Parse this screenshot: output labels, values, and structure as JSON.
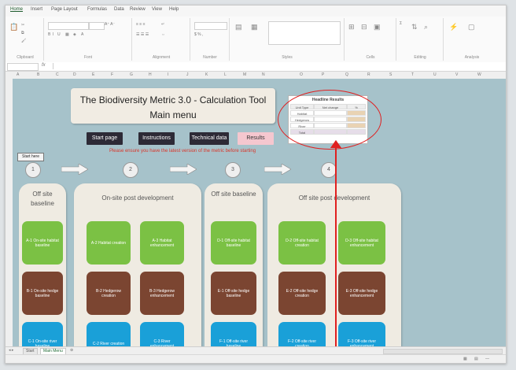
{
  "ribbon": {
    "tabs": [
      "Home",
      "Insert",
      "Page Layout",
      "Formulas",
      "Data",
      "Review",
      "View",
      "Help"
    ],
    "groups": [
      "Clipboard",
      "Font",
      "Alignment",
      "Number",
      "Styles",
      "Cells",
      "Editing",
      "Analysis"
    ]
  },
  "sheet": {
    "title_line1": "The Biodiversity Metric 3.0 - Calculation Tool",
    "title_line2": "Main menu",
    "nav_buttons": [
      "Start page",
      "Instructions",
      "Technical data",
      "Results"
    ],
    "warning": "Please ensure you have the latest version of the metric before starting",
    "start_here": "Start here",
    "steps": [
      "1",
      "2",
      "3",
      "4"
    ],
    "headline": {
      "title": "Headline Results",
      "cols": [
        "Unit Type",
        "Net change",
        "%"
      ],
      "rows": [
        "Habitat",
        "Hedgerow",
        "River",
        "Total"
      ]
    },
    "panels": [
      {
        "title": "Off site baseline",
        "cards": [
          "A-1 On-site habitat baseline",
          "B-1 On-site hedge baseline",
          "C-1 On-site river baseline"
        ]
      },
      {
        "title": "On-site post development",
        "cards": [
          "A-2 Habitat creation",
          "A-3 Habitat enhancement",
          "B-2 Hedgerow creation",
          "B-3 Hedgerow enhancement",
          "C-2 River creation",
          "C-3 River enhancement"
        ]
      },
      {
        "title": "Off site baseline",
        "cards": [
          "D-1 Off-site habitat baseline",
          "E-1 Off-site hedge baseline",
          "F-1 Off-site river baseline"
        ]
      },
      {
        "title": "Off site post development",
        "cards": [
          "D-2 Off-site habitat creation",
          "D-3 Off-site habitat enhancement",
          "E-2 Off-site hedge creation",
          "E-3 Off-site hedge enhancement",
          "F-2 Off-site river creation",
          "F-3 Off-site river enhancement"
        ]
      }
    ]
  },
  "sheet_tabs": [
    "Start",
    "Main Menu"
  ],
  "colors": {
    "sheet_bg": "#a6c2ca",
    "green": "#7bc144",
    "brown": "#7b4531",
    "blue": "#1aa0d8",
    "annotation": "#e02020"
  }
}
